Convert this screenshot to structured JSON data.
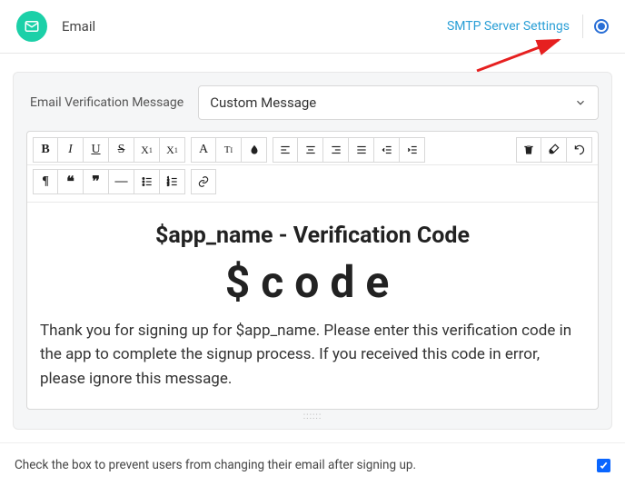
{
  "header": {
    "title": "Email",
    "smtp_link": "SMTP Server Settings"
  },
  "panel": {
    "label": "Email Verification Message",
    "select_value": "Custom Message"
  },
  "editor": {
    "heading": "$app_name - Verification Code",
    "code": "$code",
    "body": "Thank you for signing up for $app_name. Please enter this verification code in the app to complete the signup process. If you received this code in error, please ignore this message."
  },
  "footer": {
    "text": "Check the box to prevent users from changing their email after signing up.",
    "checked": true
  },
  "colors": {
    "accent": "#1cd0a8",
    "link": "#2a9fd6",
    "radio": "#2a6fd6",
    "checkbox": "#0a66ff"
  }
}
